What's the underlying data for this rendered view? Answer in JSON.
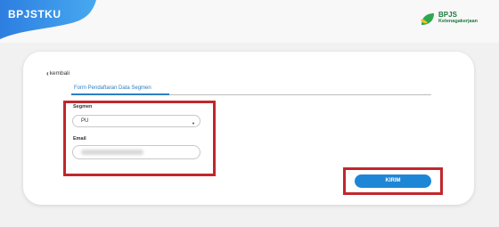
{
  "app": {
    "logo": "BPJSTKU",
    "brand_name": "BPJS",
    "brand_sub": "Ketenagakerjaan"
  },
  "nav": {
    "back_label": "kembali"
  },
  "form": {
    "title": "Form Pendaftaran Data Segmen",
    "segmen": {
      "label": "Segmen",
      "value": "PU"
    },
    "email": {
      "label": "Email",
      "value": ""
    },
    "submit_label": "KIRIM"
  },
  "colors": {
    "accent": "#1e86d6",
    "highlight": "#c1272d",
    "brand_green": "#1f7a3f"
  },
  "icons": {
    "back": "chevron-left-icon",
    "dropdown": "caret-down-icon"
  }
}
